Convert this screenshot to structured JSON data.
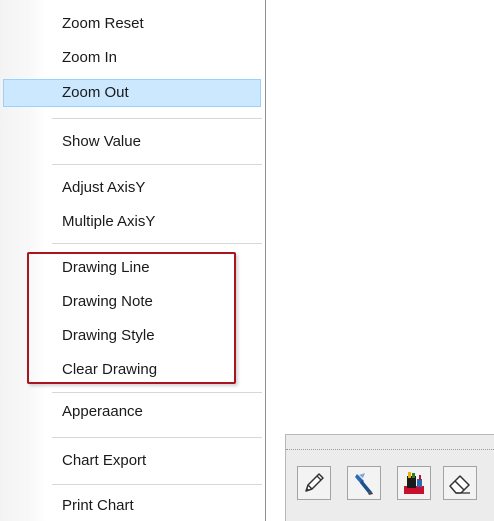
{
  "menu": {
    "items": [
      {
        "label": "Zoom Reset"
      },
      {
        "label": "Zoom In"
      },
      {
        "label": "Zoom Out",
        "highlighted": true
      },
      {
        "label": "Show Value"
      },
      {
        "label": "Adjust AxisY"
      },
      {
        "label": "Multiple AxisY"
      },
      {
        "label": "Drawing Line"
      },
      {
        "label": "Drawing Note"
      },
      {
        "label": "Drawing Style"
      },
      {
        "label": "Clear Drawing"
      },
      {
        "label": "Apperaance"
      },
      {
        "label": "Chart Export"
      },
      {
        "label": "Print Chart"
      }
    ]
  },
  "toolbar": {
    "buttons": [
      {
        "icon": "pencil-icon"
      },
      {
        "icon": "note-pen-icon"
      },
      {
        "icon": "style-palette-icon"
      },
      {
        "icon": "eraser-icon"
      }
    ]
  },
  "colors": {
    "highlight": "#cce8ff",
    "highlight_border": "#99d1ff",
    "group_border": "#a8151f"
  }
}
